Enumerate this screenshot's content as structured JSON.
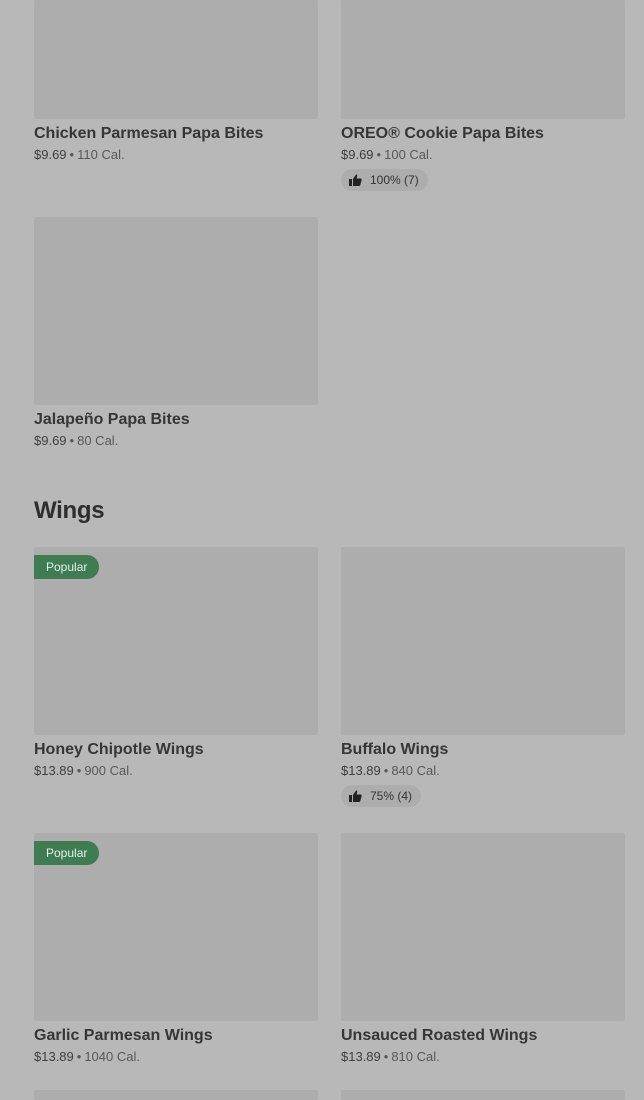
{
  "top_items": [
    {
      "name": "Chicken Parmesan Papa Bites",
      "price": "$9.69",
      "cal": "110 Cal."
    },
    {
      "name": "OREO® Cookie Papa Bites",
      "price": "$9.69",
      "cal": "100 Cal.",
      "rating": "100% (7)"
    }
  ],
  "jalapeno": {
    "name": "Jalapeño Papa Bites",
    "price": "$9.69",
    "cal": "80 Cal."
  },
  "wings_section": {
    "title": "Wings",
    "items": [
      {
        "name": "Honey Chipotle Wings",
        "price": "$13.89",
        "cal": "900 Cal.",
        "badge": "Popular"
      },
      {
        "name": "Buffalo Wings",
        "price": "$13.89",
        "cal": "840 Cal.",
        "rating": "75% (4)"
      },
      {
        "name": "Garlic Parmesan Wings",
        "price": "$13.89",
        "cal": "1040 Cal.",
        "badge": "Popular"
      },
      {
        "name": "Unsauced Roasted Wings",
        "price": "$13.89",
        "cal": "810 Cal."
      }
    ]
  },
  "separator": "•",
  "icons": {
    "rating": "thumbs-up-icon"
  },
  "colors": {
    "badge": "#3f7c52",
    "background": "#b8b8b8",
    "thumbnail": "#adadad"
  }
}
